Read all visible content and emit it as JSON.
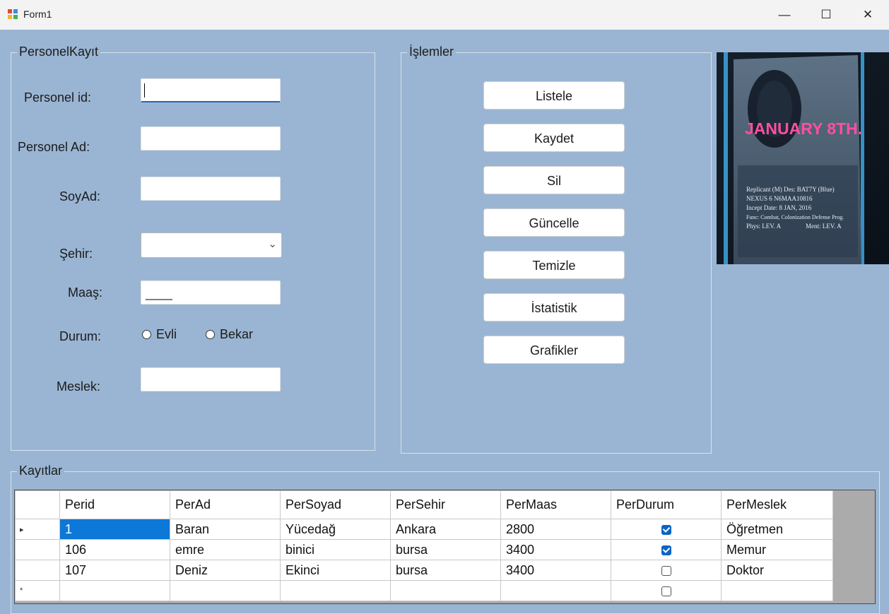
{
  "window": {
    "title": "Form1",
    "minimize": "—",
    "maximize": "☐",
    "close": "✕"
  },
  "personel": {
    "group_title": "PersonelKayıt",
    "id_label": "Personel id:",
    "ad_label": "Personel Ad:",
    "soyad_label": "SoyAd:",
    "sehir_label": "Şehir:",
    "maas_label": "Maaş:",
    "maas_mask": "____",
    "durum_label": "Durum:",
    "evli": "Evli",
    "bekar": "Bekar",
    "meslek_label": "Meslek:"
  },
  "islemler": {
    "group_title": "İşlemler",
    "buttons": [
      "Listele",
      "Kaydet",
      "Sil",
      "Güncelle",
      "Temizle",
      "İstatistik",
      "Grafikler"
    ]
  },
  "picture": {
    "headline": "JANUARY 8TH.",
    "lines": [
      "Replicant (M) Des: BAT7Y (Blue)",
      "NEXUS 6  N6MAA10816",
      "Incept Date:  8 JAN, 2016",
      "Func: Combat, Colonization Defense Prog.",
      "Phys: LEV. A",
      "Ment: LEV. A"
    ]
  },
  "kayitlar": {
    "group_title": "Kayıtlar",
    "columns": [
      "Perid",
      "PerAd",
      "PerSoyad",
      "PerSehir",
      "PerMaas",
      "PerDurum",
      "PerMeslek"
    ],
    "rows": [
      {
        "marker": "▸",
        "perid": "1",
        "perad": "Baran",
        "persoyad": "Yücedağ",
        "persehir": "Ankara",
        "permaas": "2800",
        "perdurum": true,
        "permeslek": "Öğretmen"
      },
      {
        "marker": "",
        "perid": "106",
        "perad": "emre",
        "persoyad": "binici",
        "persehir": "bursa",
        "permaas": "3400",
        "perdurum": true,
        "permeslek": "Memur"
      },
      {
        "marker": "",
        "perid": "107",
        "perad": "Deniz",
        "persoyad": "Ekinci",
        "persehir": "bursa",
        "permaas": "3400",
        "perdurum": false,
        "permeslek": "Doktor"
      }
    ],
    "new_row_marker": "*"
  }
}
